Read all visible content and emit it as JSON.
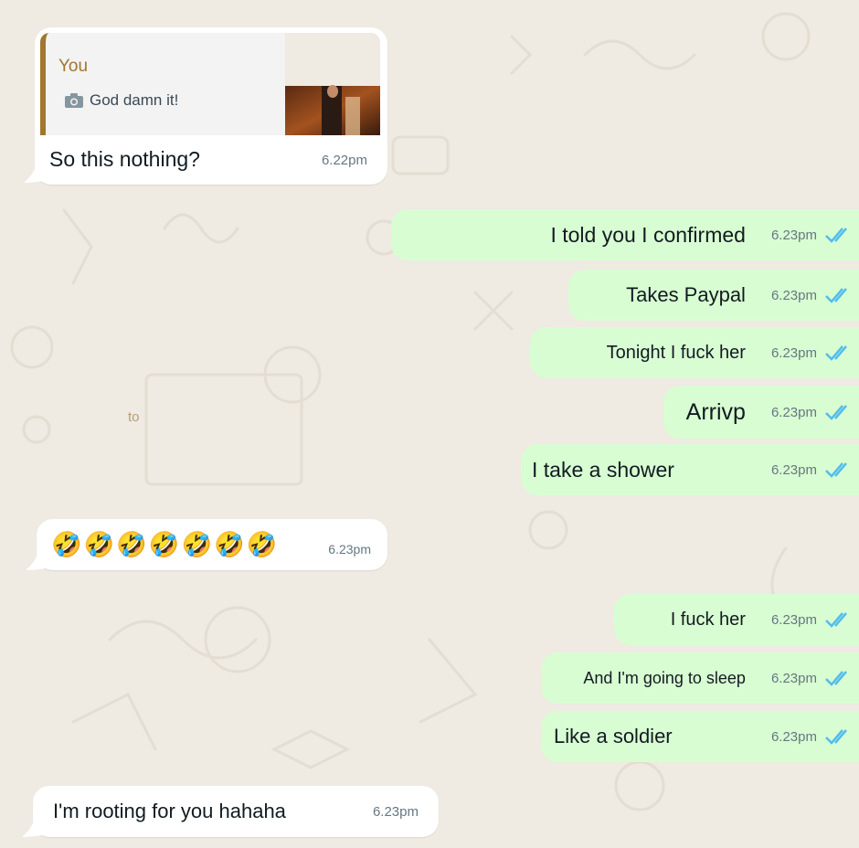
{
  "colors": {
    "incoming": "#ffffff",
    "outgoing": "#d9fdd3",
    "quote_accent": "#a0772c",
    "read_ticks": "#53bdeb"
  },
  "quoted_reply": {
    "sender": "You",
    "icon": "camera-icon",
    "text": "God damn it!"
  },
  "background_text": "to",
  "messages": [
    {
      "dir": "in",
      "text": "So this nothing?",
      "time": "6.22pm"
    },
    {
      "dir": "out",
      "text": "I told you I confirmed",
      "time": "6.23pm"
    },
    {
      "dir": "out",
      "text": "Takes Paypal",
      "time": "6.23pm"
    },
    {
      "dir": "out",
      "text": "Tonight I fuck her",
      "time": "6.23pm"
    },
    {
      "dir": "out",
      "text": "Arrivp",
      "time": "6.23pm"
    },
    {
      "dir": "out",
      "text": "I take a shower",
      "time": "6.23pm"
    },
    {
      "dir": "in",
      "text": "🤣🤣🤣🤣🤣🤣🤣",
      "time": "6.23pm"
    },
    {
      "dir": "out",
      "text": "I fuck her",
      "time": "6.23pm"
    },
    {
      "dir": "out",
      "text": "And I'm going to sleep",
      "time": "6.23pm"
    },
    {
      "dir": "out",
      "text": "Like a soldier",
      "time": "6.23pm"
    },
    {
      "dir": "in",
      "text": "I'm rooting for you hahaha",
      "time": "6.23pm"
    }
  ]
}
